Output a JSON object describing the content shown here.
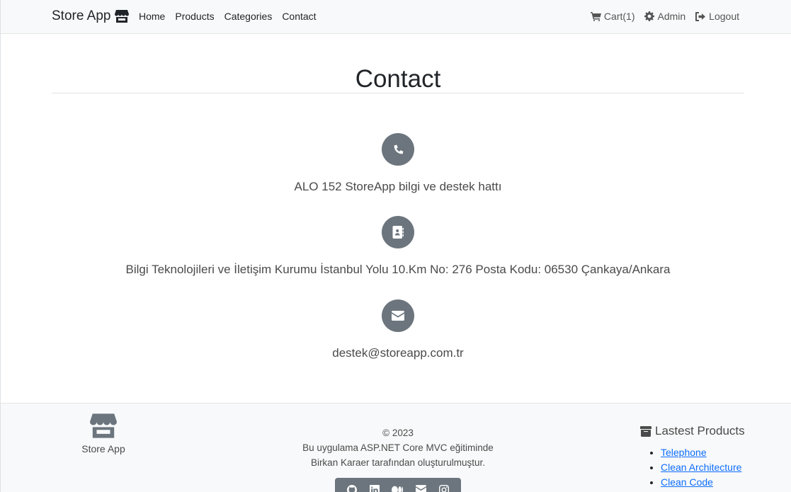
{
  "navbar": {
    "brand": "Store App",
    "links": [
      "Home",
      "Products",
      "Categories",
      "Contact"
    ],
    "cart": "Cart(1)",
    "admin": "Admin",
    "logout": "Logout"
  },
  "main": {
    "title": "Contact",
    "phone": "ALO 152 StoreApp bilgi ve destek hattı",
    "address": "Bilgi Teknolojileri ve İletişim Kurumu İstanbul Yolu 10.Km No: 276 Posta Kodu: 06530 Çankaya/Ankara",
    "email": "destek@storeapp.com.tr"
  },
  "footer": {
    "logo_name": "Store App",
    "copyright": "© 2023",
    "line1": "Bu uygulama ASP.NET Core MVC eğitiminde",
    "line2": "Birkan Karaer tarafından oluşturulmuştur.",
    "latest_title": "Lastest Products",
    "latest_products": [
      "Telephone",
      "Clean Architecture",
      "Clean Code"
    ]
  },
  "icons": [
    "store-icon",
    "cart-icon",
    "gear-icon",
    "logout-icon",
    "phone-icon",
    "address-book-icon",
    "envelope-icon",
    "box-icon",
    "github-icon",
    "linkedin-icon",
    "medium-icon",
    "envelope-icon",
    "instagram-icon"
  ]
}
